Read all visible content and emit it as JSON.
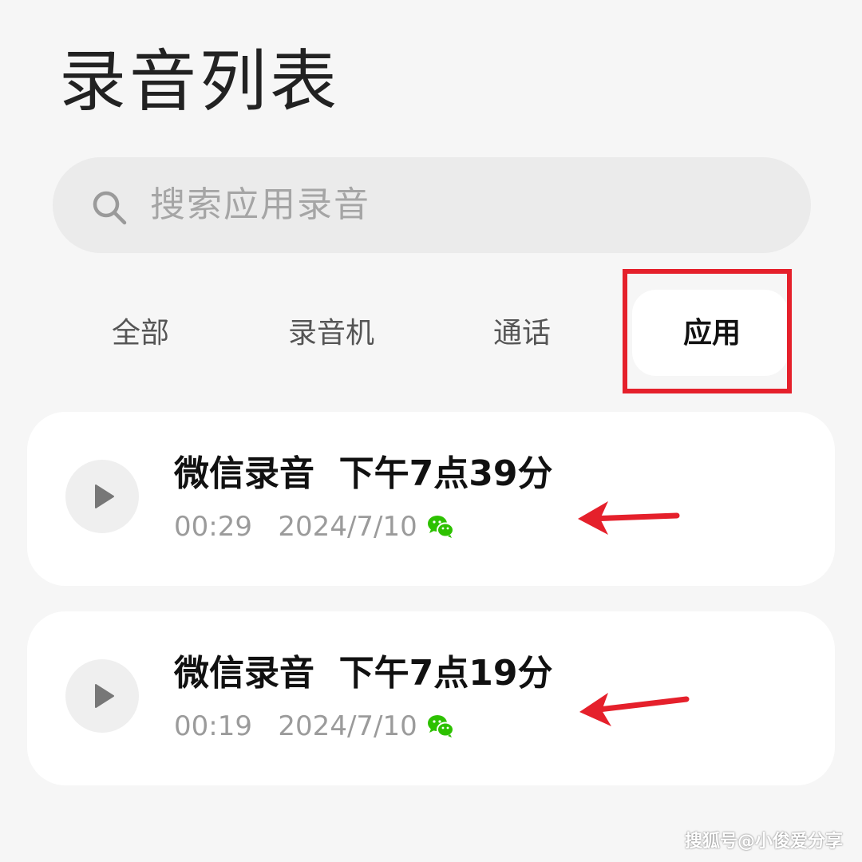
{
  "header": {
    "title": "录音列表"
  },
  "search": {
    "placeholder": "搜索应用录音"
  },
  "tabs": [
    {
      "label": "全部",
      "active": false
    },
    {
      "label": "录音机",
      "active": false
    },
    {
      "label": "通话",
      "active": false
    },
    {
      "label": "应用",
      "active": true
    }
  ],
  "recordings": [
    {
      "title": "微信录音  下午7点39分",
      "duration": "00:29",
      "date": "2024/7/10",
      "source_icon": "wechat-icon"
    },
    {
      "title": "微信录音  下午7点19分",
      "duration": "00:19",
      "date": "2024/7/10",
      "source_icon": "wechat-icon"
    }
  ],
  "annotations": {
    "highlight_color": "#e5202b"
  },
  "watermark": {
    "text": "搜狐号@小俊爱分享"
  },
  "colors": {
    "background": "#f6f6f6",
    "card": "#ffffff",
    "search_bg": "#ebebeb",
    "wechat_green": "#2dc100",
    "annotation_red": "#e5202b"
  }
}
